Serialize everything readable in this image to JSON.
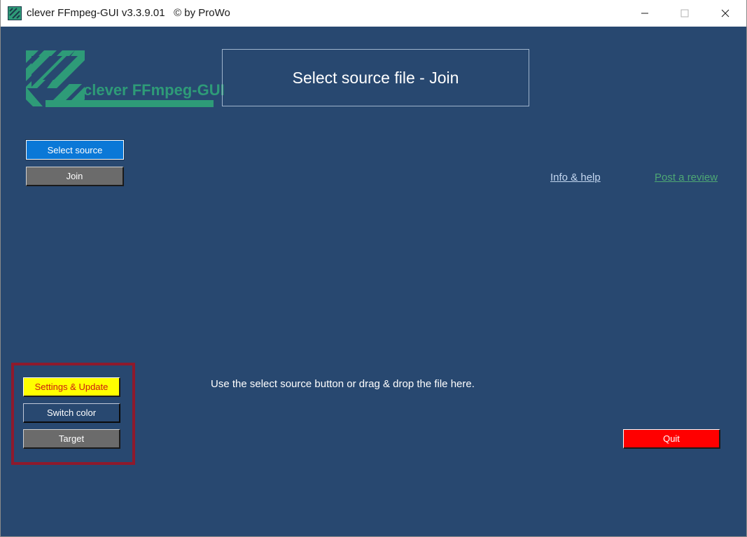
{
  "window": {
    "title": "clever FFmpeg-GUI v3.3.9.01   © by ProWo",
    "icon": "app-logo-icon",
    "controls": {
      "minimize_icon": "minimize-icon",
      "maximize_icon": "maximize-icon",
      "close_icon": "close-icon"
    }
  },
  "logo": {
    "text": "clever FFmpeg-GUI",
    "color": "#2e9b78"
  },
  "header": {
    "title": "Select source file - Join"
  },
  "actions": {
    "select_source_label": "Select source",
    "join_label": "Join"
  },
  "links": {
    "info_help": "Info & help",
    "post_review": "Post a review"
  },
  "hint": "Use the select source button or drag & drop the file here.",
  "bottom_left": {
    "settings_label": "Settings & Update",
    "switch_color_label": "Switch color",
    "target_label": "Target"
  },
  "quit_label": "Quit",
  "colors": {
    "background": "#284870",
    "select_button": "#0a78d7",
    "settings_button": "#ffff00",
    "quit_button": "#ff0000",
    "highlight_border": "#8e1a2c"
  }
}
